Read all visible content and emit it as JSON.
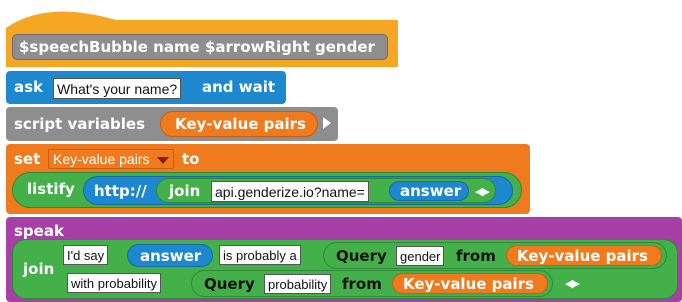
{
  "colors": {
    "control": "#f5a623",
    "sensing": "#1e88cf",
    "variables": "#f07a1e",
    "lists": "#e05a1b",
    "operators": "#43b04a",
    "looks": "#a640a6",
    "other": "#8e8e8e"
  },
  "hat_block": {
    "icons": [
      "speech-bubble-icon",
      "arrow-right-icon"
    ],
    "text": "$speechBubble name $arrowRight gender"
  },
  "ask_block": {
    "keyword": "ask",
    "question": "What's your name?",
    "suffix": "and wait"
  },
  "script_variables_block": {
    "keyword": "script variables",
    "variable": "Key-value pairs"
  },
  "set_block": {
    "keyword": "set",
    "variable": "Key-value pairs",
    "to": "to",
    "listify_label": "listify",
    "url_prefix": "http://",
    "join_label": "join",
    "url_text": "api.genderize.io?name=",
    "answer_label": "answer"
  },
  "speak_block": {
    "keyword": "speak",
    "join_label": "join",
    "row1": {
      "text1": "I'd say",
      "answer_label": "answer",
      "text2": "is probably a",
      "query_label": "Query",
      "query_key": "gender",
      "from_label": "from",
      "variable": "Key-value pairs"
    },
    "row2": {
      "text1": "with probability",
      "query_label": "Query",
      "query_key": "probability",
      "from_label": "from",
      "variable": "Key-value pairs"
    }
  }
}
